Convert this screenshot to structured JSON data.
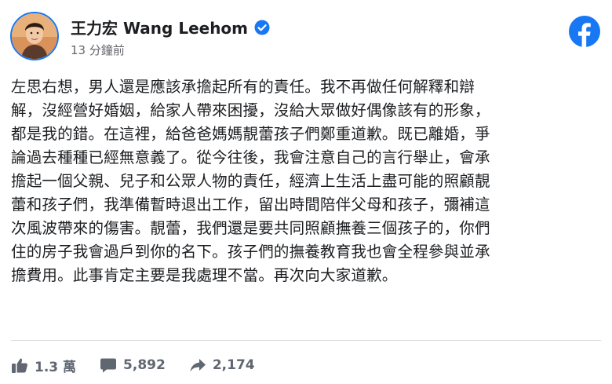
{
  "post": {
    "author": "王力宏 Wang Leehom",
    "timestamp": "13 分鐘前",
    "text_lines": [
      "左思右想，男人還是應該承擔起所有的責任。我不再做任何解釋和辯",
      "解，沒經營好婚姻，給家人帶來困擾，沒給大眾做好偶像該有的形象，",
      "都是我的錯。在這裡，給爸爸媽媽靚蕾孩子們鄭重道歉。既已離婚，爭",
      "論過去種種已經無意義了。從今往後，我會注意自己的言行舉止，會承",
      "擔起一個父親、兒子和公眾人物的責任，經濟上生活上盡可能的照顧靚",
      "蕾和孩子們，我準備暫時退出工作，留出時間陪伴父母和孩子，彌補這",
      "次風波帶來的傷害。靚蕾，我們還是要共同照顧撫養三個孩子的，你們",
      "住的房子我會過戶到你的名下。孩子們的撫養教育我也會全程參與並承",
      "擔費用。此事肯定主要是我處理不當。再次向大家道歉。"
    ]
  },
  "stats": {
    "likes": "1.3 萬",
    "comments": "5,892",
    "shares": "2,174"
  },
  "icons": {
    "avatar": "profile-photo",
    "verified": "verified-badge-icon",
    "facebook": "facebook-logo-icon",
    "like": "thumbs-up-icon",
    "comment": "comment-bubble-icon",
    "share": "share-arrow-icon"
  },
  "colors": {
    "facebook_blue": "#1877f2",
    "text": "#1c1e21",
    "secondary_text": "#65676b",
    "stat_icon": "#606770"
  }
}
